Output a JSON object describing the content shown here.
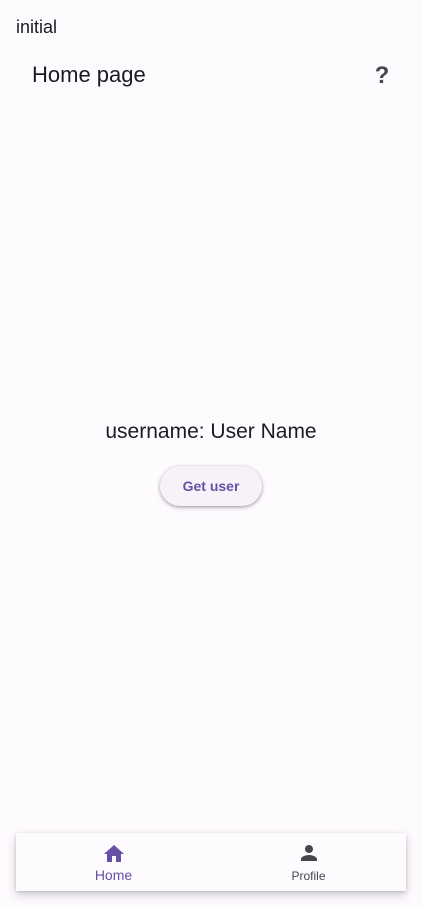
{
  "status": {
    "text": "initial"
  },
  "app_bar": {
    "title": "Home page",
    "help_icon": "?"
  },
  "main": {
    "username_text": "username: User Name",
    "get_user_label": "Get user"
  },
  "bottom_nav": {
    "items": [
      {
        "label": "Home",
        "icon": "home-icon",
        "active": true
      },
      {
        "label": "Profile",
        "icon": "person-icon",
        "active": false
      }
    ]
  },
  "colors": {
    "background": "#fefbff",
    "primary": "#6750a4",
    "on_surface": "#1c1b1f",
    "on_surface_variant": "#49454f",
    "button_surface": "#f7f2fa"
  }
}
